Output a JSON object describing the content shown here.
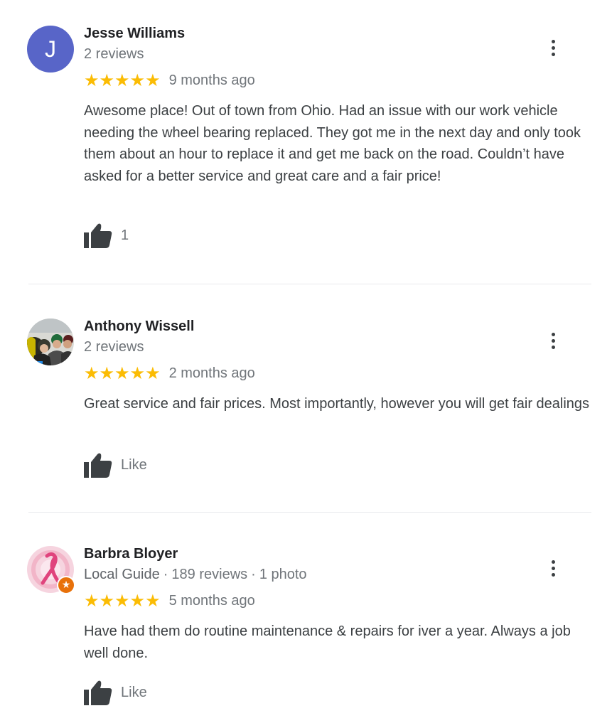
{
  "reviews": [
    {
      "avatar_letter": "J",
      "avatar_color": "#5865c8",
      "name": "Jesse Williams",
      "guide_label": "",
      "review_count": "2 reviews",
      "photo_count": "",
      "stars": 5,
      "stars_glyphs": "★★★★★",
      "time": "9 months ago",
      "text": "Awesome place! Out of town from Ohio. Had an issue with our work vehicle needing the wheel bearing replaced. They got me in the next day and only took them about an hour to replace it and get me back on the road. Couldn’t have asked for a better service and great care and a fair price!",
      "like_label": "1"
    },
    {
      "avatar_letter": "",
      "name": "Anthony Wissell",
      "guide_label": "",
      "review_count": "2 reviews",
      "photo_count": "",
      "stars": 5,
      "stars_glyphs": "★★★★★",
      "time": "2 months ago",
      "text": "Great service and fair prices.  Most importantly, however you will get fair dealings",
      "like_label": "Like"
    },
    {
      "avatar_letter": "",
      "name": "Barbra Bloyer",
      "guide_label": "Local Guide",
      "review_count": "189 reviews",
      "photo_count": "1 photo",
      "stars": 5,
      "stars_glyphs": "★★★★★",
      "time": "5 months ago",
      "text": "Have had them do routine maintenance & repairs for iver a year.  Always a job well done.",
      "like_label": "Like"
    }
  ],
  "icons": {
    "more": "more-vert-icon",
    "like": "thumbs-up-icon",
    "star": "star-icon",
    "local_guide_badge": "local-guide-badge-icon"
  },
  "colors": {
    "star": "#fbbc04",
    "secondary_text": "#70757a",
    "divider": "#e8eaed",
    "local_guide_badge": "#e8710a"
  }
}
